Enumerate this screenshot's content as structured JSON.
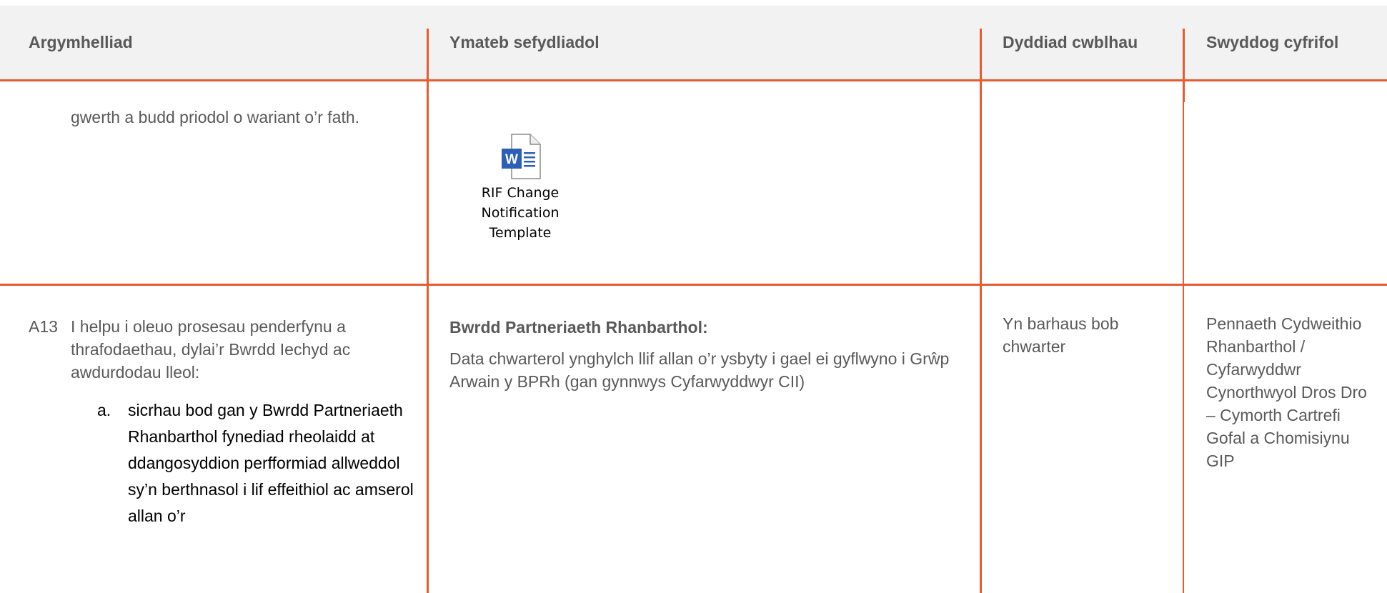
{
  "table": {
    "headers": {
      "recommendation": "Argymhelliad",
      "response": "Ymateb sefydliadol",
      "date": "Dyddiad cwblhau",
      "officer": "Swyddog cyfrifol"
    },
    "row1": {
      "recommendation_cont": "gwerth a budd priodol o wariant o’r fath.",
      "attachment": {
        "icon": "word-document-icon",
        "caption_line1": "RIF Change",
        "caption_line2": "Notification Template"
      }
    },
    "row2": {
      "id": "A13",
      "recommendation": "I helpu i oleuo prosesau penderfynu a thrafodaethau, dylai’r Bwrdd Iechyd ac awdurdodau lleol:",
      "sub_item_letter": "a.",
      "sub_item_text": "sicrhau bod gan y Bwrdd Partneriaeth Rhanbarthol fynediad rheolaidd at ddangosyddion perfformiad allweddol sy’n berthnasol i lif effeithiol ac amserol allan o’r",
      "response_heading": "Bwrdd Partneriaeth Rhanbarthol:",
      "response_text": "Data chwarterol ynghylch llif allan o’r ysbyty i gael ei gyflwyno i Grŵp Arwain y BPRh (gan gynnwys Cyfarwyddwyr CII)",
      "date": "Yn barhaus bob chwarter",
      "officer": "Pennaeth Cydweithio Rhanbarthol / Cyfarwyddwr Cynorthwyol Dros Dro – Cymorth Cartrefi Gofal a Chomisiynu GIP"
    }
  },
  "colors": {
    "rule": "#e85b2e",
    "header_bg": "#f2f2f2",
    "text": "#595959"
  }
}
